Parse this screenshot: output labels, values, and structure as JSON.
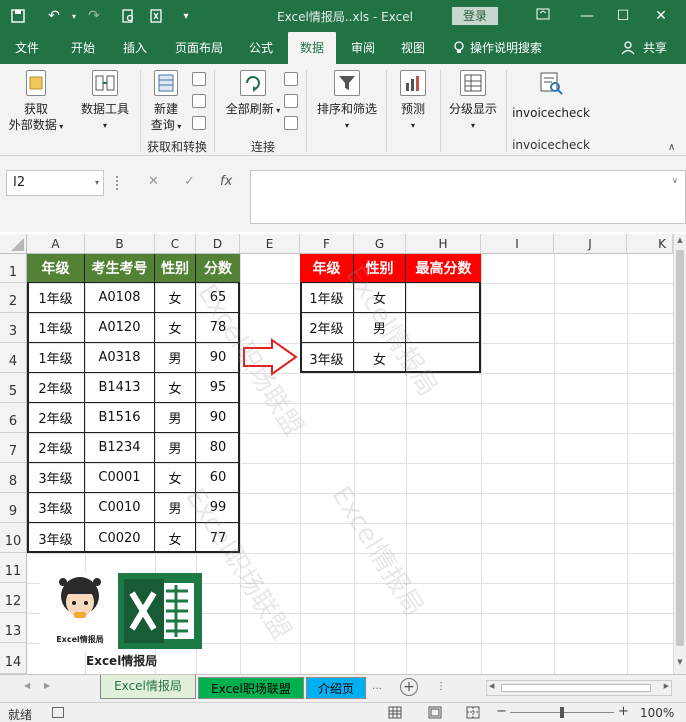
{
  "window": {
    "title": "Excel情报局..xls  -  Excel",
    "login": "登录"
  },
  "menu_tabs": [
    "文件",
    "开始",
    "插入",
    "页面布局",
    "公式",
    "数据",
    "审阅",
    "视图"
  ],
  "active_tab": "数据",
  "tell_me": "操作说明搜索",
  "share": "共享",
  "ribbon": {
    "get_data": [
      "获取",
      "外部数据"
    ],
    "data_tools": "数据工具",
    "new_query": [
      "新建",
      "查询"
    ],
    "group_get_transform": "获取和转换",
    "refresh_all": "全部刷新",
    "group_connections": "连接",
    "sort_filter": "排序和筛选",
    "forecast": "预测",
    "outline": "分级显示",
    "invoice_btn": "invoicecheck",
    "invoice_group": "invoicecheck"
  },
  "formula_bar": {
    "name_box": "I2",
    "fx": "fx",
    "value": ""
  },
  "columns": [
    "A",
    "B",
    "C",
    "D",
    "E",
    "F",
    "G",
    "H",
    "I",
    "J",
    "K"
  ],
  "rows": [
    "1",
    "2",
    "3",
    "4",
    "5",
    "6",
    "7",
    "8",
    "9",
    "10",
    "11",
    "12",
    "13",
    "14"
  ],
  "table1": {
    "headers": [
      "年级",
      "考生考号",
      "性别",
      "分数"
    ],
    "header_color": "#538135",
    "rows": [
      [
        "1年级",
        "A0108",
        "女",
        "65"
      ],
      [
        "1年级",
        "A0120",
        "女",
        "78"
      ],
      [
        "1年级",
        "A0318",
        "男",
        "90"
      ],
      [
        "2年级",
        "B1413",
        "女",
        "95"
      ],
      [
        "2年级",
        "B1516",
        "男",
        "90"
      ],
      [
        "2年级",
        "B1234",
        "男",
        "80"
      ],
      [
        "3年级",
        "C0001",
        "女",
        "60"
      ],
      [
        "3年级",
        "C0010",
        "男",
        "99"
      ],
      [
        "3年级",
        "C0020",
        "女",
        "77"
      ]
    ]
  },
  "table2": {
    "headers": [
      "年级",
      "性别",
      "最高分数"
    ],
    "header_color": "#ff0000",
    "rows": [
      [
        "1年级",
        "女",
        ""
      ],
      [
        "2年级",
        "男",
        ""
      ],
      [
        "3年级",
        "女",
        ""
      ]
    ]
  },
  "watermark": "Excel职场联盟",
  "watermark2": "Excel情报局",
  "logo_caption": "Excel情报局",
  "logo_small": "Excel情报局",
  "sheets": [
    {
      "name": "Excel情报局",
      "color": "#e2efda",
      "active": true
    },
    {
      "name": "Excel职场联盟",
      "color": "#00b050",
      "active": false
    },
    {
      "name": "介绍页",
      "color": "#00b0f0",
      "active": false
    }
  ],
  "status": {
    "ready": "就绪",
    "zoom": "100%"
  },
  "accent": "#217346"
}
